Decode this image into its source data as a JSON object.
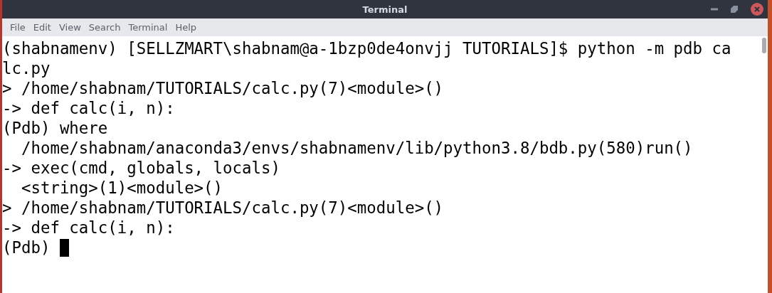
{
  "window": {
    "title": "Terminal"
  },
  "menu": [
    "File",
    "Edit",
    "View",
    "Search",
    "Terminal",
    "Help"
  ],
  "terminal": {
    "lines": [
      "(shabnamenv) [SELLZMART\\shabnam@a-1bzp0de4onvjj TUTORIALS]$ python -m pdb ca",
      "lc.py",
      "> /home/shabnam/TUTORIALS/calc.py(7)<module>()",
      "-> def calc(i, n):",
      "(Pdb) where",
      "  /home/shabnam/anaconda3/envs/shabnamenv/lib/python3.8/bdb.py(580)run()",
      "-> exec(cmd, globals, locals)",
      "  <string>(1)<module>()",
      "> /home/shabnam/TUTORIALS/calc.py(7)<module>()",
      "-> def calc(i, n):"
    ],
    "prompt": "(Pdb) "
  }
}
